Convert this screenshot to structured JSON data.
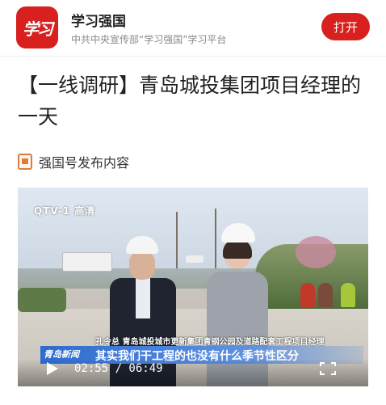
{
  "banner": {
    "logo_text": "学习",
    "app_name": "学习强国",
    "app_subtitle": "中共中央宣传部“学习强国”学习平台",
    "open_label": "打开"
  },
  "article": {
    "title": "【一线调研】青岛城投集团项目经理的一天",
    "source_label": "强国号发布内容"
  },
  "video": {
    "tv_logo": "QTV-1 高清",
    "caption_person": "孔令总  青岛城投城市更新集团青钢公园及道路配套工程项目经理",
    "caption_tag": "青岛新闻",
    "caption_main": "其实我们干工程的也没有什么季节性区分",
    "time_display": "02:55 / 06:49"
  },
  "colors": {
    "brand_red": "#d8201f",
    "caption_blue": "#2e6bd0"
  },
  "icons": {
    "play": "play-icon",
    "fullscreen": "fullscreen-icon",
    "source": "source-badge-icon"
  }
}
